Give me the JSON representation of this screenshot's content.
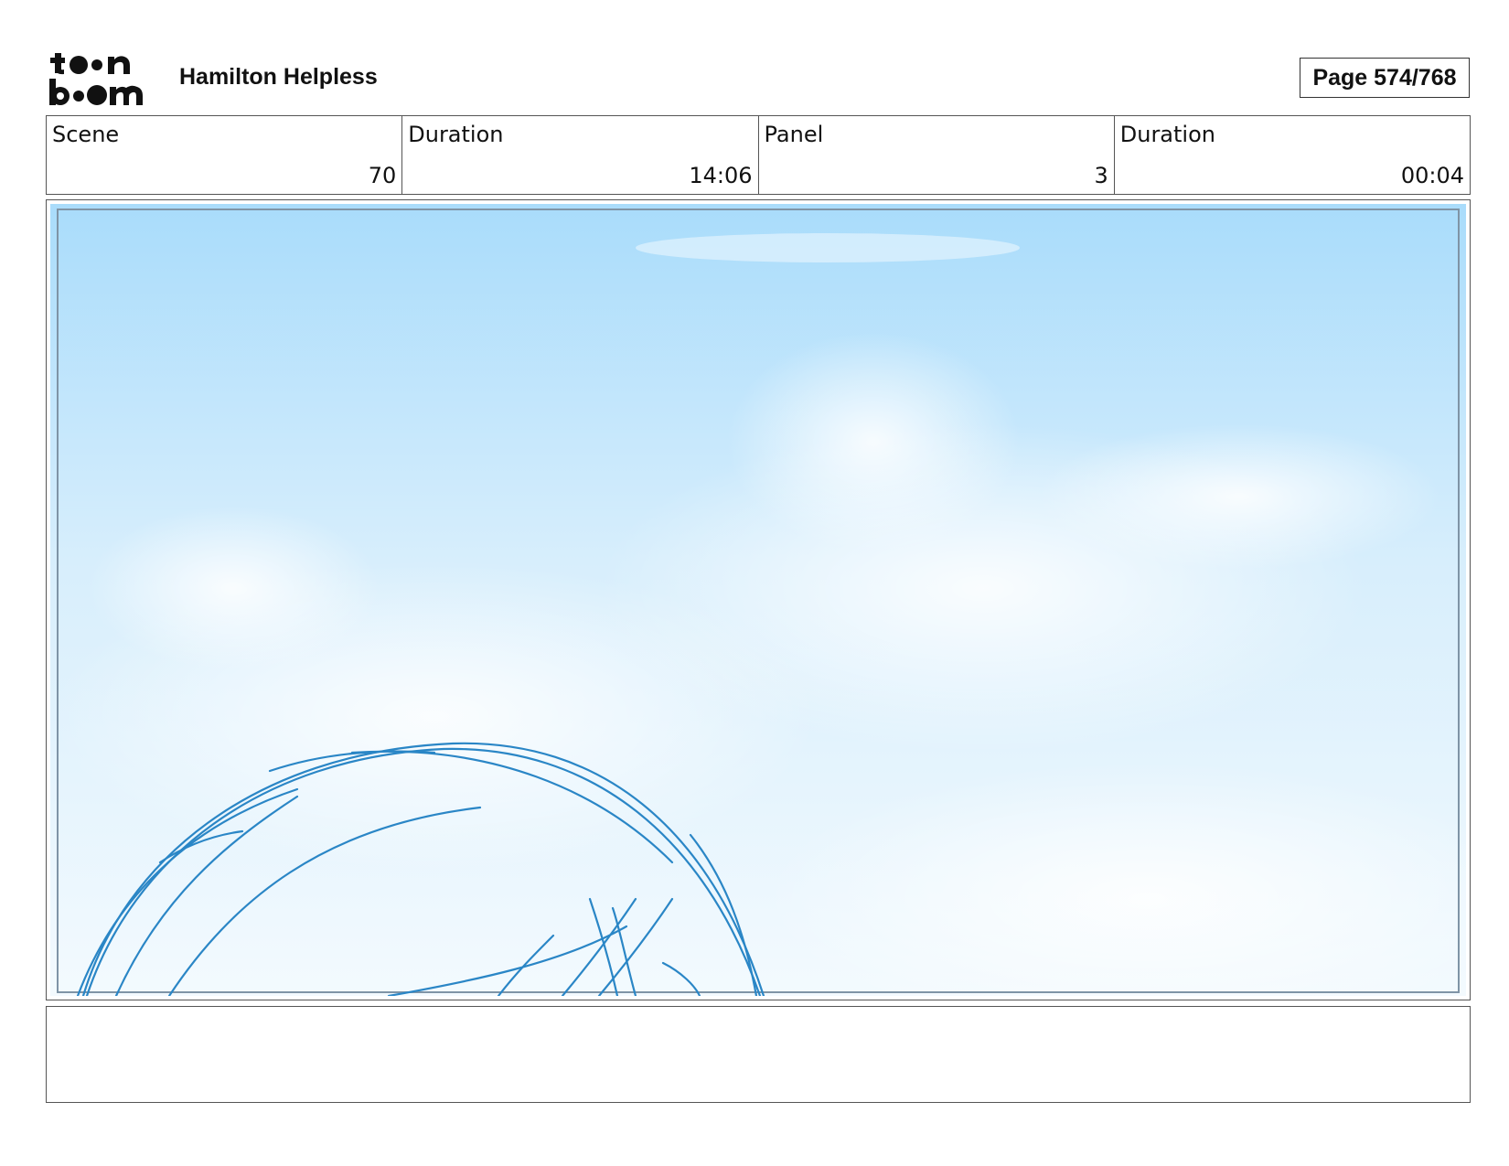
{
  "header": {
    "logo_text_top": "toon",
    "logo_text_bottom": "boom",
    "project_title": "Hamilton Helpless",
    "page_label": "Page 574/768"
  },
  "info": {
    "scene_label": "Scene",
    "scene_value": "70",
    "scene_duration_label": "Duration",
    "scene_duration_value": "14:06",
    "panel_label": "Panel",
    "panel_value": "3",
    "panel_duration_label": "Duration",
    "panel_duration_value": "00:04"
  },
  "panel": {
    "sky_top_color": "#a9dcfb",
    "sky_bottom_color": "#f3fafe",
    "sketch_color": "#2a86c6",
    "frame_color": "#7f94a6"
  },
  "notes": {
    "text": ""
  }
}
